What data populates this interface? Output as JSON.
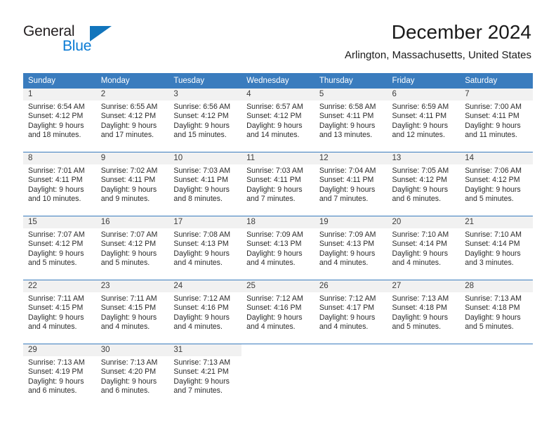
{
  "brand": {
    "name_part1": "General",
    "name_part2": "Blue",
    "logo_icon": "triangle-logo-icon",
    "accent_color": "#1275bc"
  },
  "header": {
    "title": "December 2024",
    "subtitle": "Arlington, Massachusetts, United States"
  },
  "theme": {
    "header_row_bg": "#3a7cbe",
    "daynum_band_bg": "#f1f1f1",
    "grid_line": "#3a7cbe",
    "text": "#2b2b2b"
  },
  "weekdays": [
    "Sunday",
    "Monday",
    "Tuesday",
    "Wednesday",
    "Thursday",
    "Friday",
    "Saturday"
  ],
  "weeks": [
    [
      {
        "day": "1",
        "sunrise": "Sunrise: 6:54 AM",
        "sunset": "Sunset: 4:12 PM",
        "daylight_line1": "Daylight: 9 hours",
        "daylight_line2": "and 18 minutes."
      },
      {
        "day": "2",
        "sunrise": "Sunrise: 6:55 AM",
        "sunset": "Sunset: 4:12 PM",
        "daylight_line1": "Daylight: 9 hours",
        "daylight_line2": "and 17 minutes."
      },
      {
        "day": "3",
        "sunrise": "Sunrise: 6:56 AM",
        "sunset": "Sunset: 4:12 PM",
        "daylight_line1": "Daylight: 9 hours",
        "daylight_line2": "and 15 minutes."
      },
      {
        "day": "4",
        "sunrise": "Sunrise: 6:57 AM",
        "sunset": "Sunset: 4:12 PM",
        "daylight_line1": "Daylight: 9 hours",
        "daylight_line2": "and 14 minutes."
      },
      {
        "day": "5",
        "sunrise": "Sunrise: 6:58 AM",
        "sunset": "Sunset: 4:11 PM",
        "daylight_line1": "Daylight: 9 hours",
        "daylight_line2": "and 13 minutes."
      },
      {
        "day": "6",
        "sunrise": "Sunrise: 6:59 AM",
        "sunset": "Sunset: 4:11 PM",
        "daylight_line1": "Daylight: 9 hours",
        "daylight_line2": "and 12 minutes."
      },
      {
        "day": "7",
        "sunrise": "Sunrise: 7:00 AM",
        "sunset": "Sunset: 4:11 PM",
        "daylight_line1": "Daylight: 9 hours",
        "daylight_line2": "and 11 minutes."
      }
    ],
    [
      {
        "day": "8",
        "sunrise": "Sunrise: 7:01 AM",
        "sunset": "Sunset: 4:11 PM",
        "daylight_line1": "Daylight: 9 hours",
        "daylight_line2": "and 10 minutes."
      },
      {
        "day": "9",
        "sunrise": "Sunrise: 7:02 AM",
        "sunset": "Sunset: 4:11 PM",
        "daylight_line1": "Daylight: 9 hours",
        "daylight_line2": "and 9 minutes."
      },
      {
        "day": "10",
        "sunrise": "Sunrise: 7:03 AM",
        "sunset": "Sunset: 4:11 PM",
        "daylight_line1": "Daylight: 9 hours",
        "daylight_line2": "and 8 minutes."
      },
      {
        "day": "11",
        "sunrise": "Sunrise: 7:03 AM",
        "sunset": "Sunset: 4:11 PM",
        "daylight_line1": "Daylight: 9 hours",
        "daylight_line2": "and 7 minutes."
      },
      {
        "day": "12",
        "sunrise": "Sunrise: 7:04 AM",
        "sunset": "Sunset: 4:11 PM",
        "daylight_line1": "Daylight: 9 hours",
        "daylight_line2": "and 7 minutes."
      },
      {
        "day": "13",
        "sunrise": "Sunrise: 7:05 AM",
        "sunset": "Sunset: 4:12 PM",
        "daylight_line1": "Daylight: 9 hours",
        "daylight_line2": "and 6 minutes."
      },
      {
        "day": "14",
        "sunrise": "Sunrise: 7:06 AM",
        "sunset": "Sunset: 4:12 PM",
        "daylight_line1": "Daylight: 9 hours",
        "daylight_line2": "and 5 minutes."
      }
    ],
    [
      {
        "day": "15",
        "sunrise": "Sunrise: 7:07 AM",
        "sunset": "Sunset: 4:12 PM",
        "daylight_line1": "Daylight: 9 hours",
        "daylight_line2": "and 5 minutes."
      },
      {
        "day": "16",
        "sunrise": "Sunrise: 7:07 AM",
        "sunset": "Sunset: 4:12 PM",
        "daylight_line1": "Daylight: 9 hours",
        "daylight_line2": "and 5 minutes."
      },
      {
        "day": "17",
        "sunrise": "Sunrise: 7:08 AM",
        "sunset": "Sunset: 4:13 PM",
        "daylight_line1": "Daylight: 9 hours",
        "daylight_line2": "and 4 minutes."
      },
      {
        "day": "18",
        "sunrise": "Sunrise: 7:09 AM",
        "sunset": "Sunset: 4:13 PM",
        "daylight_line1": "Daylight: 9 hours",
        "daylight_line2": "and 4 minutes."
      },
      {
        "day": "19",
        "sunrise": "Sunrise: 7:09 AM",
        "sunset": "Sunset: 4:13 PM",
        "daylight_line1": "Daylight: 9 hours",
        "daylight_line2": "and 4 minutes."
      },
      {
        "day": "20",
        "sunrise": "Sunrise: 7:10 AM",
        "sunset": "Sunset: 4:14 PM",
        "daylight_line1": "Daylight: 9 hours",
        "daylight_line2": "and 4 minutes."
      },
      {
        "day": "21",
        "sunrise": "Sunrise: 7:10 AM",
        "sunset": "Sunset: 4:14 PM",
        "daylight_line1": "Daylight: 9 hours",
        "daylight_line2": "and 3 minutes."
      }
    ],
    [
      {
        "day": "22",
        "sunrise": "Sunrise: 7:11 AM",
        "sunset": "Sunset: 4:15 PM",
        "daylight_line1": "Daylight: 9 hours",
        "daylight_line2": "and 4 minutes."
      },
      {
        "day": "23",
        "sunrise": "Sunrise: 7:11 AM",
        "sunset": "Sunset: 4:15 PM",
        "daylight_line1": "Daylight: 9 hours",
        "daylight_line2": "and 4 minutes."
      },
      {
        "day": "24",
        "sunrise": "Sunrise: 7:12 AM",
        "sunset": "Sunset: 4:16 PM",
        "daylight_line1": "Daylight: 9 hours",
        "daylight_line2": "and 4 minutes."
      },
      {
        "day": "25",
        "sunrise": "Sunrise: 7:12 AM",
        "sunset": "Sunset: 4:16 PM",
        "daylight_line1": "Daylight: 9 hours",
        "daylight_line2": "and 4 minutes."
      },
      {
        "day": "26",
        "sunrise": "Sunrise: 7:12 AM",
        "sunset": "Sunset: 4:17 PM",
        "daylight_line1": "Daylight: 9 hours",
        "daylight_line2": "and 4 minutes."
      },
      {
        "day": "27",
        "sunrise": "Sunrise: 7:13 AM",
        "sunset": "Sunset: 4:18 PM",
        "daylight_line1": "Daylight: 9 hours",
        "daylight_line2": "and 5 minutes."
      },
      {
        "day": "28",
        "sunrise": "Sunrise: 7:13 AM",
        "sunset": "Sunset: 4:18 PM",
        "daylight_line1": "Daylight: 9 hours",
        "daylight_line2": "and 5 minutes."
      }
    ],
    [
      {
        "day": "29",
        "sunrise": "Sunrise: 7:13 AM",
        "sunset": "Sunset: 4:19 PM",
        "daylight_line1": "Daylight: 9 hours",
        "daylight_line2": "and 6 minutes."
      },
      {
        "day": "30",
        "sunrise": "Sunrise: 7:13 AM",
        "sunset": "Sunset: 4:20 PM",
        "daylight_line1": "Daylight: 9 hours",
        "daylight_line2": "and 6 minutes."
      },
      {
        "day": "31",
        "sunrise": "Sunrise: 7:13 AM",
        "sunset": "Sunset: 4:21 PM",
        "daylight_line1": "Daylight: 9 hours",
        "daylight_line2": "and 7 minutes."
      },
      {
        "day": "",
        "sunrise": "",
        "sunset": "",
        "daylight_line1": "",
        "daylight_line2": ""
      },
      {
        "day": "",
        "sunrise": "",
        "sunset": "",
        "daylight_line1": "",
        "daylight_line2": ""
      },
      {
        "day": "",
        "sunrise": "",
        "sunset": "",
        "daylight_line1": "",
        "daylight_line2": ""
      },
      {
        "day": "",
        "sunrise": "",
        "sunset": "",
        "daylight_line1": "",
        "daylight_line2": ""
      }
    ]
  ]
}
